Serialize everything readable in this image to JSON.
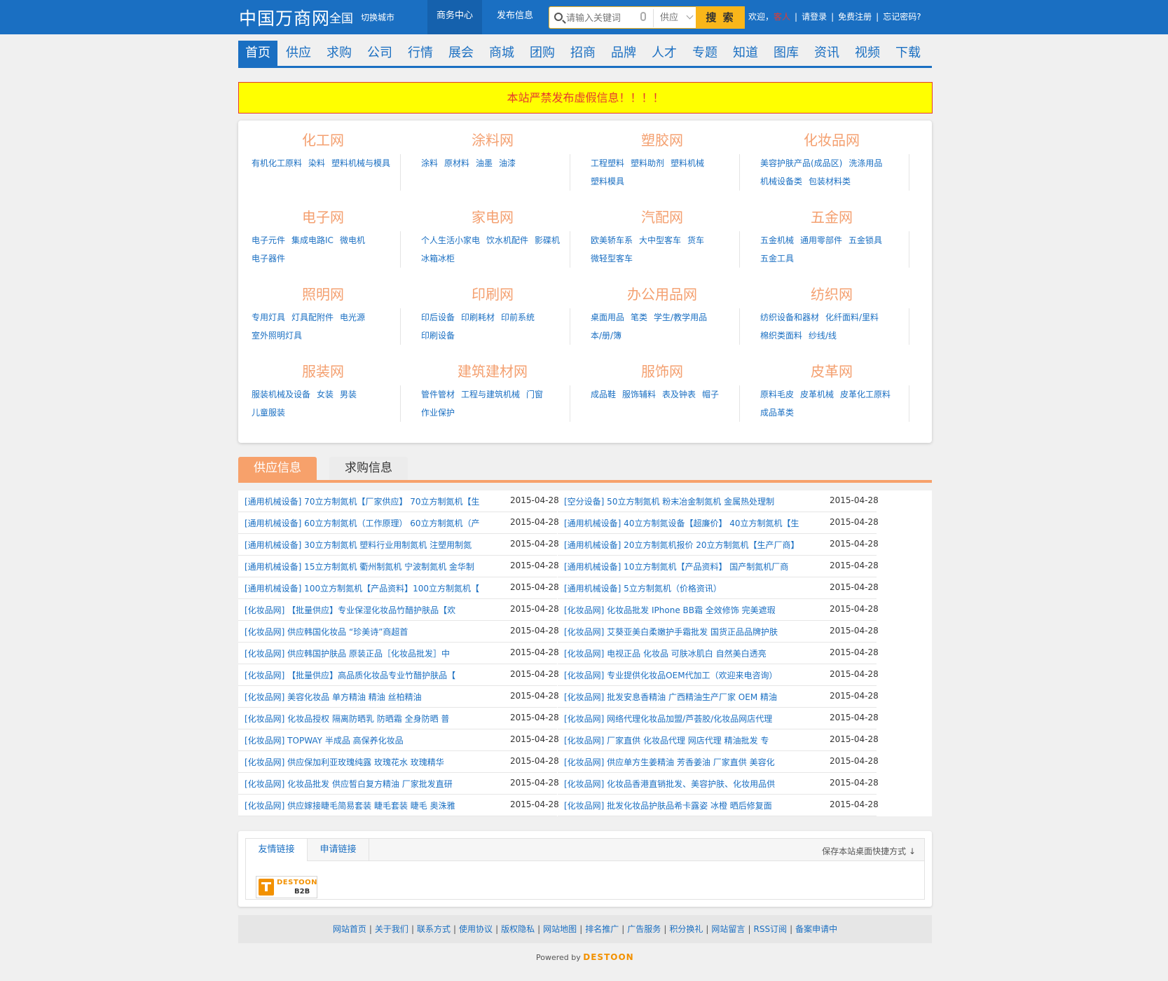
{
  "header": {
    "logo": "中国万商网",
    "city": "全国",
    "switch_city": "切换城市",
    "biz_center": "商务中心",
    "post_info": "发布信息",
    "search_placeholder": "请输入关键词",
    "search_type": "供应",
    "search_button": "搜 索",
    "welcome": "欢迎，",
    "guest": "客人",
    "login": "请登录",
    "register": "免费注册",
    "forgot": "忘记密码?"
  },
  "nav": [
    "首页",
    "供应",
    "求购",
    "公司",
    "行情",
    "展会",
    "商城",
    "团购",
    "招商",
    "品牌",
    "人才",
    "专题",
    "知道",
    "图库",
    "资讯",
    "视频",
    "下载"
  ],
  "notice": "本站严禁发布虚假信息！！！！",
  "categories": [
    {
      "title": "化工网",
      "links": [
        "有机化工原料",
        "染料",
        "塑料机械与模具"
      ]
    },
    {
      "title": "涂料网",
      "links": [
        "涂料",
        "原材料",
        "油墨",
        "油漆"
      ]
    },
    {
      "title": "塑胶网",
      "links": [
        "工程塑料",
        "塑料助剂",
        "塑料机械",
        "塑料模具"
      ]
    },
    {
      "title": "化妆品网",
      "links": [
        "美容护肤产品(成品区)",
        "洗涤用品",
        "机械设备类",
        "包装材料类"
      ]
    },
    {
      "title": "电子网",
      "links": [
        "电子元件",
        "集成电路IC",
        "微电机",
        "电子器件"
      ]
    },
    {
      "title": "家电网",
      "links": [
        "个人生活小家电",
        "饮水机配件",
        "影碟机",
        "冰箱冰柜"
      ]
    },
    {
      "title": "汽配网",
      "links": [
        "欧美轿车系",
        "大中型客车",
        "货车",
        "微轻型客车"
      ]
    },
    {
      "title": "五金网",
      "links": [
        "五金机械",
        "通用零部件",
        "五金锁具",
        "五金工具"
      ]
    },
    {
      "title": "照明网",
      "links": [
        "专用灯具",
        "灯具配附件",
        "电光源",
        "室外照明灯具"
      ]
    },
    {
      "title": "印刷网",
      "links": [
        "印后设备",
        "印刷耗材",
        "印前系统",
        "印刷设备"
      ]
    },
    {
      "title": "办公用品网",
      "links": [
        "桌面用品",
        "笔类",
        "学生/教学用品",
        "本/册/簿"
      ]
    },
    {
      "title": "纺织网",
      "links": [
        "纺织设备和器材",
        "化纤面料/里料",
        "棉织类面料",
        "纱线/线"
      ]
    },
    {
      "title": "服装网",
      "links": [
        "服装机械及设备",
        "女装",
        "男装",
        "儿童服装"
      ]
    },
    {
      "title": "建筑建材网",
      "links": [
        "管件管材",
        "工程与建筑机械",
        "门窗",
        "作业保护"
      ]
    },
    {
      "title": "服饰网",
      "links": [
        "成品鞋",
        "服饰辅料",
        "表及钟表",
        "帽子"
      ]
    },
    {
      "title": "皮革网",
      "links": [
        "原料毛皮",
        "皮革机械",
        "皮革化工原料",
        "成品革类"
      ]
    }
  ],
  "tabs": {
    "supply": "供应信息",
    "buy": "求购信息"
  },
  "supply_left": [
    {
      "title": "[通用机械设备] 70立方制氮机【厂家供应】 70立方制氮机【生",
      "date": "2015-04-28"
    },
    {
      "title": "[通用机械设备] 60立方制氮机（工作原理） 60立方制氮机（产",
      "date": "2015-04-28"
    },
    {
      "title": "[通用机械设备] 30立方制氮机 塑料行业用制氮机 注塑用制氮",
      "date": "2015-04-28"
    },
    {
      "title": "[通用机械设备] 15立方制氮机 衢州制氮机 宁波制氮机 金华制",
      "date": "2015-04-28"
    },
    {
      "title": "[通用机械设备] 100立方制氮机【产品资料】100立方制氮机【",
      "date": "2015-04-28"
    },
    {
      "title": "[化妆品网] 【批量供应】专业保湿化妆品竹醋护肤品【欢",
      "date": "2015-04-28"
    },
    {
      "title": "[化妆品网] 供应韩国化妆品 “珍美诗”商超首",
      "date": "2015-04-28"
    },
    {
      "title": "[化妆品网] 供应韩国护肤品 原装正品［化妆品批发］中",
      "date": "2015-04-28"
    },
    {
      "title": "[化妆品网] 【批量供应】高品质化妆品专业竹醋护肤品【",
      "date": "2015-04-28"
    },
    {
      "title": "[化妆品网] 美容化妆品 单方精油 精油 丝柏精油",
      "date": "2015-04-28"
    },
    {
      "title": "[化妆品网] 化妆品授权 隔离防晒乳 防晒霜 全身防晒 普",
      "date": "2015-04-28"
    },
    {
      "title": "[化妆品网] TOPWAY 半成品 高保养化妆品",
      "date": "2015-04-28"
    },
    {
      "title": "[化妆品网] 供应保加利亚玫瑰纯露 玫瑰花水 玫瑰精华",
      "date": "2015-04-28"
    },
    {
      "title": "[化妆品网] 化妆品批发 供应皙白复方精油 厂家批发直研",
      "date": "2015-04-28"
    },
    {
      "title": "[化妆品网] 供应嫁接睫毛简易套装 睫毛套装 睫毛 奥洙雅",
      "date": "2015-04-28"
    }
  ],
  "supply_right": [
    {
      "title": "[空分设备] 50立方制氮机 粉末冶金制氮机 金属热处理制",
      "date": "2015-04-28"
    },
    {
      "title": "[通用机械设备] 40立方制氮设备【超廉价】 40立方制氮机【生",
      "date": "2015-04-28"
    },
    {
      "title": "[通用机械设备] 20立方制氮机报价 20立方制氮机【生产厂商】",
      "date": "2015-04-28"
    },
    {
      "title": "[通用机械设备] 10立方制氮机【产品资料】 国产制氮机厂商",
      "date": "2015-04-28"
    },
    {
      "title": "[通用机械设备] 5立方制氮机（价格资讯）",
      "date": "2015-04-28"
    },
    {
      "title": "[化妆品网] 化妆品批发 IPhone BB霜 全效修饰 完美遮瑕",
      "date": "2015-04-28"
    },
    {
      "title": "[化妆品网] 艾葵亚美白柔嫩护手霜批发 国货正品品牌护肤",
      "date": "2015-04-28"
    },
    {
      "title": "[化妆品网] 电视正品 化妆品 可肤冰肌白 自然美白透亮",
      "date": "2015-04-28"
    },
    {
      "title": "[化妆品网] 专业提供化妆品OEM代加工（欢迎来电咨询）",
      "date": "2015-04-28"
    },
    {
      "title": "[化妆品网] 批发安息香精油 广西精油生产厂家 OEM 精油",
      "date": "2015-04-28"
    },
    {
      "title": "[化妆品网] 网络代理化妆品加盟/芦荟胶/化妆品网店代理",
      "date": "2015-04-28"
    },
    {
      "title": "[化妆品网] 厂家直供 化妆品代理 网店代理 精油批发 专",
      "date": "2015-04-28"
    },
    {
      "title": "[化妆品网] 供应单方生姜精油 芳香姜油 厂家直供 美容化",
      "date": "2015-04-28"
    },
    {
      "title": "[化妆品网] 化妆品香港直销批发、美容护肤、化妆用品供",
      "date": "2015-04-28"
    },
    {
      "title": "[化妆品网] 批发化妆品护肤品希卡露姿 冰橙 晒后修复面",
      "date": "2015-04-28"
    }
  ],
  "friends": {
    "tab_friend": "友情链接",
    "tab_apply": "申请链接",
    "save_shortcut": "保存本站桌面快捷方式 ↓",
    "logo_top": "DESTOON",
    "logo_bottom": "B2B"
  },
  "footer_links": [
    "网站首页",
    "关于我们",
    "联系方式",
    "使用协议",
    "版权隐私",
    "网站地图",
    "排名推广",
    "广告服务",
    "积分换礼",
    "网站留言",
    "RSS订阅",
    "备案申请中"
  ],
  "powered": {
    "prefix": "Powered by",
    "brand": "DESTOON"
  },
  "colors": {
    "brand_blue": "#1a6fc2",
    "accent_orange": "#f7a16b",
    "search_yellow": "#f9b61a",
    "notice_yellow": "#ffff00",
    "notice_red": "#e53a2e"
  }
}
